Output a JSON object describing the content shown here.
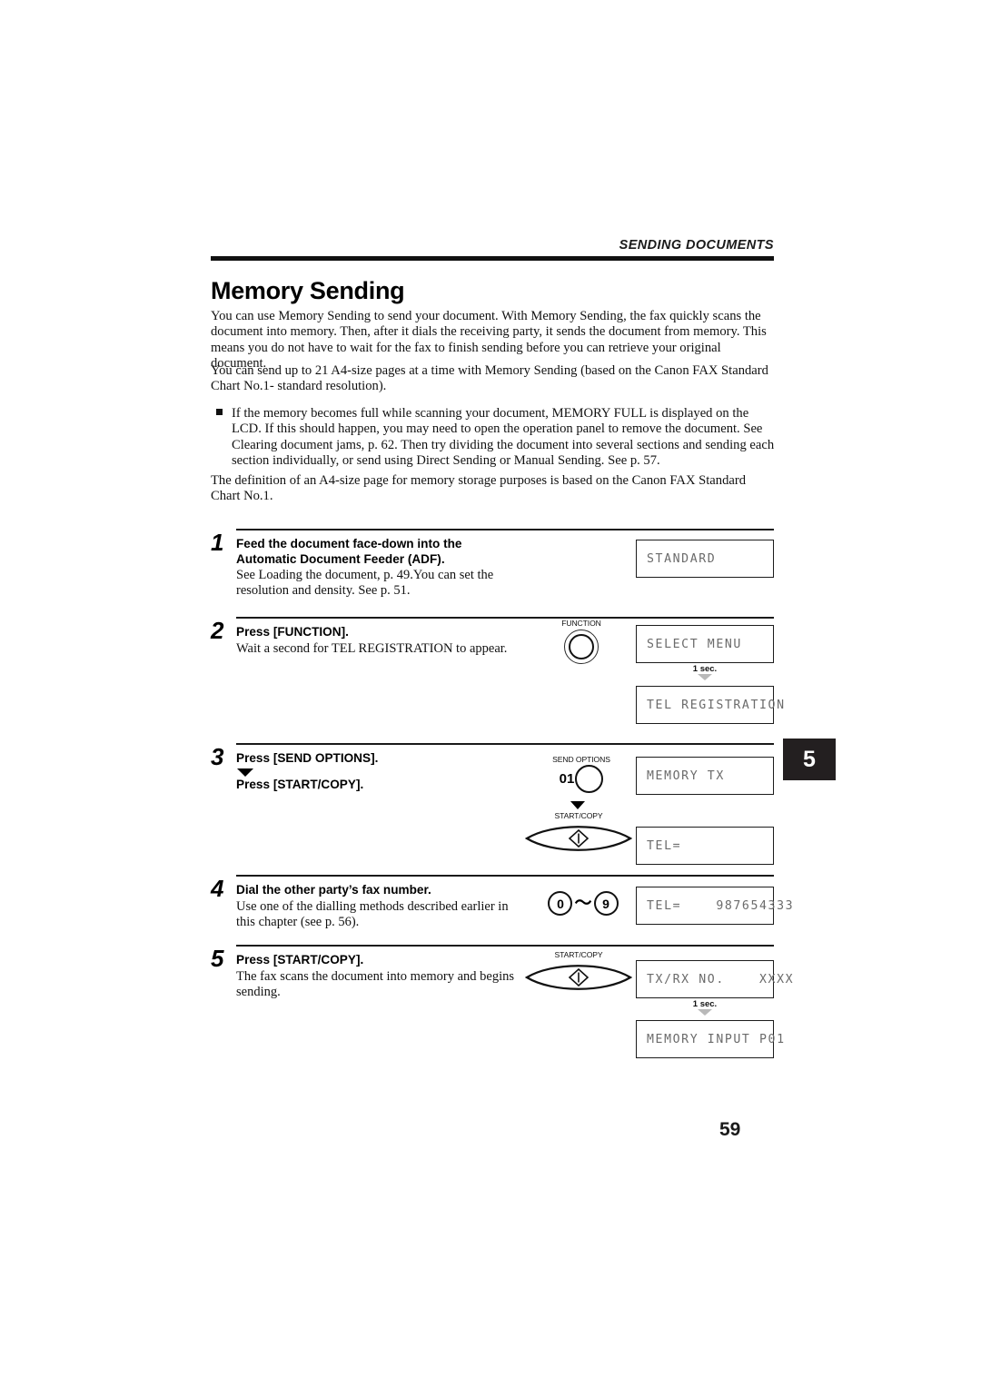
{
  "header": {
    "running_title": "SENDING DOCUMENTS"
  },
  "section": {
    "title": "Memory Sending",
    "intro_paragraph_1": "You can use Memory Sending to send your document. With Memory Sending, the fax quickly scans the document into memory. Then, after it dials the receiving party, it sends the document from memory. This means you do not have to wait for the fax to finish sending before you can retrieve your original document.",
    "intro_paragraph_2": "You can send up to 21 A4-size pages at a time with Memory Sending (based on the Canon FAX Standard Chart No.1- standard resolution).",
    "bullet_note": "If the memory becomes full while scanning your document, MEMORY FULL is displayed on the LCD. If this should happen, you may need to open the operation panel to remove the document. See Clearing document jams, p. 62. Then try dividing the document into several sections and sending each section individually, or send using Direct Sending or Manual Sending. See p. 57.",
    "closing_paragraph": "The definition of an A4-size page for memory storage purposes is based on the Canon FAX Standard Chart No.1."
  },
  "steps": [
    {
      "number": "1",
      "heading_line_1": "Feed the document face-down into the",
      "heading_line_2": "Automatic Document Feeder (ADF).",
      "description": "See Loading the document, p. 49.You can set the resolution and density. See p. 51."
    },
    {
      "number": "2",
      "heading_line_1": "Press [FUNCTION].",
      "heading_line_2": "",
      "description": "Wait a second for TEL REGISTRATION to appear."
    },
    {
      "number": "3",
      "heading_line_1": "Press [SEND OPTIONS].",
      "heading_line_2": "Press [START/COPY].",
      "description": ""
    },
    {
      "number": "4",
      "heading_line_1": "Dial the other party’s fax number.",
      "heading_line_2": "",
      "description": "Use one of the dialling methods described earlier in this chapter (see p. 56)."
    },
    {
      "number": "5",
      "heading_line_1": "Press [START/COPY].",
      "heading_line_2": "",
      "description": "The fax scans the document into memory and begins sending."
    }
  ],
  "lcd_displays": [
    {
      "id": "lcd-standard",
      "text": "STANDARD"
    },
    {
      "id": "lcd-select-menu",
      "text": "SELECT MENU"
    },
    {
      "id": "lcd-tel-registration",
      "text": "TEL REGISTRATION"
    },
    {
      "id": "lcd-memory-tx",
      "text": "MEMORY TX"
    },
    {
      "id": "lcd-tel-empty",
      "text": "TEL="
    },
    {
      "id": "lcd-tel-number",
      "text": "TEL=    987654333"
    },
    {
      "id": "lcd-txrx-no",
      "text": "TX/RX NO.    XXXX"
    },
    {
      "id": "lcd-memory-input",
      "text": "MEMORY INPUT P01"
    }
  ],
  "buttons": {
    "function": "FUNCTION",
    "send_options": "SEND OPTIONS",
    "send_options_code": "01",
    "start_copy": "START/COPY",
    "keypad_from": "0",
    "keypad_tilde": "〜",
    "keypad_to": "9"
  },
  "delay_markers": {
    "one_second": "1 sec."
  },
  "chapter_tab": "5",
  "page_number": "59",
  "colors": {
    "ink": "#111111",
    "lcd_text": "#6b6b6b",
    "tab_background": "#231f20",
    "delay_triangle": "#b9b9b9"
  }
}
